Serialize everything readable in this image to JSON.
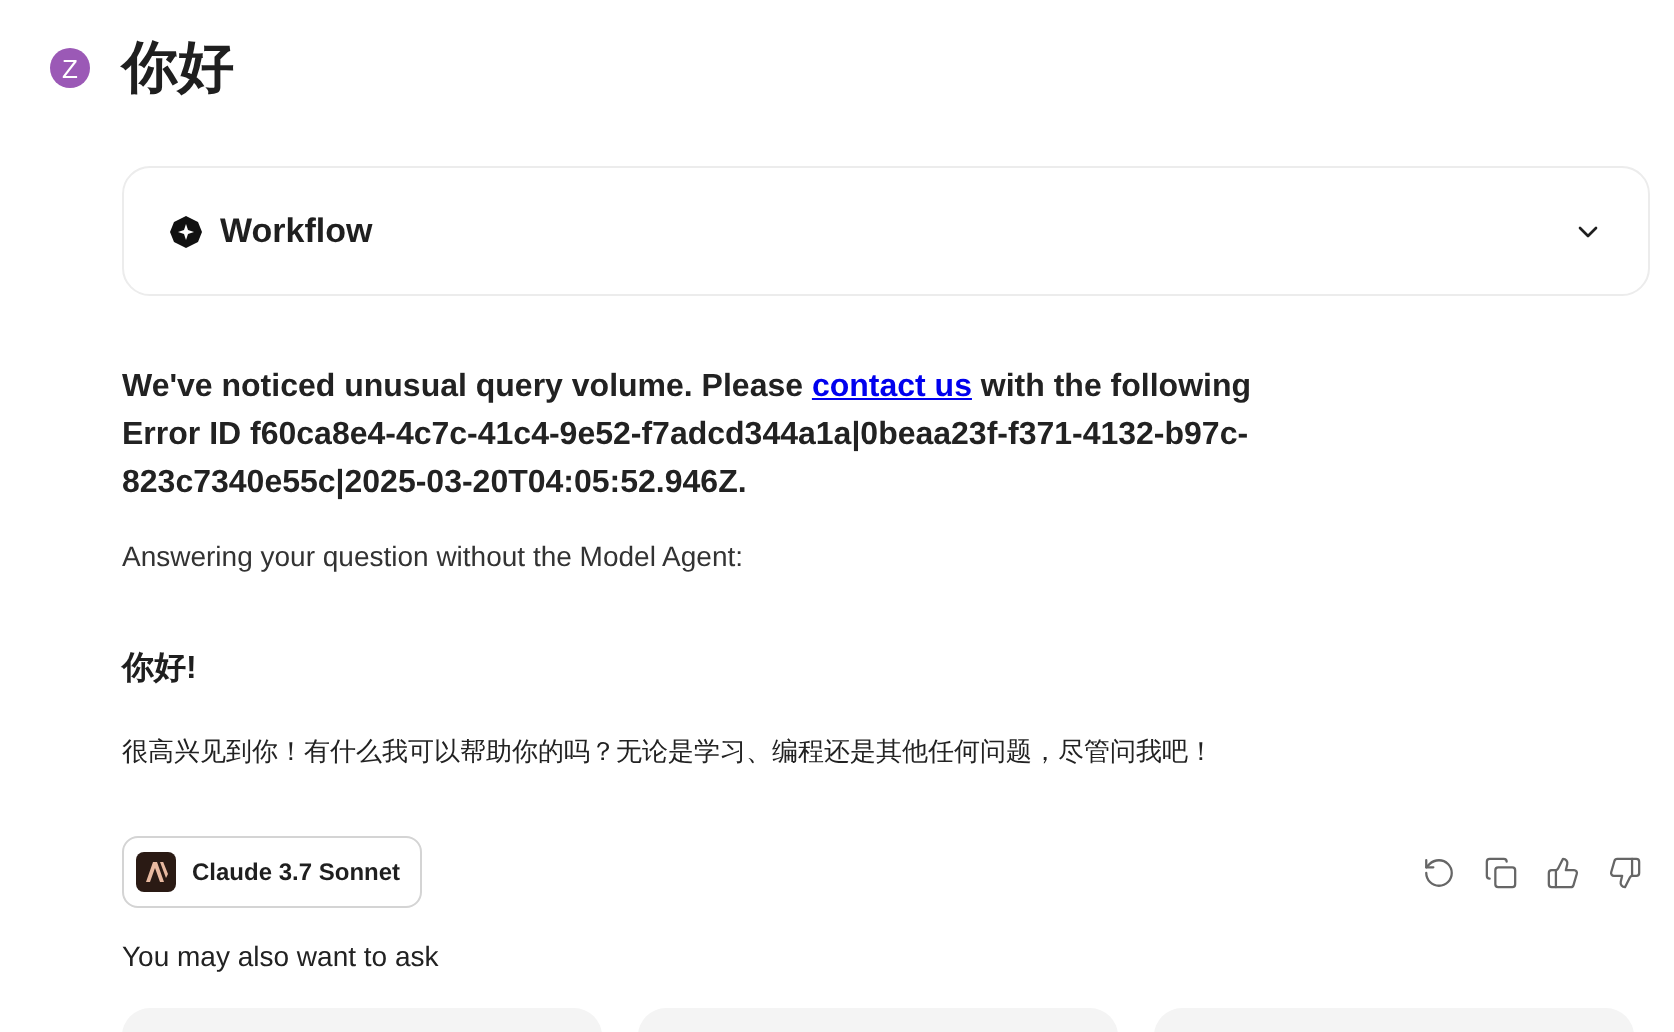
{
  "avatar": {
    "letter": "Z",
    "color": "#9b59b6"
  },
  "title": "你好",
  "workflow": {
    "label": "Workflow",
    "expanded": false
  },
  "notice": {
    "before": "We've noticed unusual query volume. Please ",
    "link": "contact us",
    "after": " with the following Error ID f60ca8e4-4c7c-41c4-9e52-f7adcd344a1a|0beaa23f-f371-4132-b97c-823c7340e55c|2025-03-20T04:05:52.946Z."
  },
  "fallback_note": "Answering your question without the Model Agent:",
  "answer": {
    "heading": "你好!",
    "body": "很高兴见到你！有什么我可以帮助你的吗？无论是学习、编程还是其他任何问题，尽管问我吧！"
  },
  "model": {
    "name": "Claude 3.7 Sonnet"
  },
  "actions": [
    {
      "kind": "retry"
    },
    {
      "kind": "copy"
    },
    {
      "kind": "like"
    },
    {
      "kind": "dislike"
    }
  ],
  "suggestions_label": "You may also want to ask"
}
